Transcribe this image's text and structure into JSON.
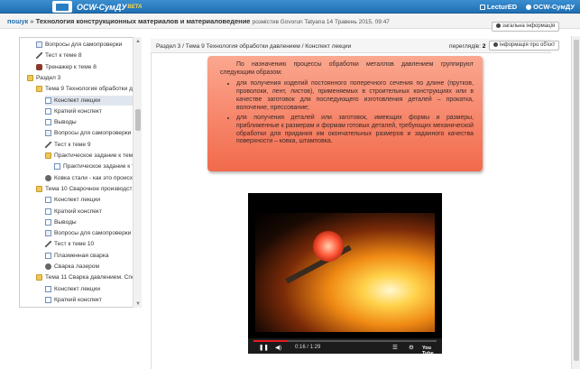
{
  "top_bar": {
    "brand": "ОСW-СумДУ",
    "beta": "BETA",
    "lectured": "LecturED",
    "account": "ОСW-СумДУ"
  },
  "title_bar": {
    "search_link": "пошук",
    "sep": "»",
    "course_title": "Технология конструкционных материалов и материаловедение",
    "author": "розмістив Govorun Tatyana 14 Травень 2015, 09:47",
    "general_info_button": "загальна інформація"
  },
  "sidebar": {
    "items": [
      {
        "label": "Вопросы для самопроверки",
        "icon": "question-icon",
        "indent": 1
      },
      {
        "label": "Тест к теме 8",
        "icon": "pencil-icon",
        "indent": 1
      },
      {
        "label": "Тренажер к теме 8",
        "icon": "wrench-icon",
        "indent": 1
      },
      {
        "label": "Раздел 3",
        "icon": "folder-icon",
        "indent": 0
      },
      {
        "label": "Тема 9 Технология обработки д",
        "icon": "folder-icon",
        "indent": 1
      },
      {
        "label": "Конспект лекции",
        "icon": "doc-icon",
        "indent": 2,
        "selected": true
      },
      {
        "label": "Краткий конспект",
        "icon": "doc-icon",
        "indent": 2
      },
      {
        "label": "Выводы",
        "icon": "doc-icon",
        "indent": 2
      },
      {
        "label": "Вопросы для самопроверки",
        "icon": "question-icon",
        "indent": 2
      },
      {
        "label": "Тест к теме 9",
        "icon": "pencil-icon",
        "indent": 2
      },
      {
        "label": "Практическое задание к теме",
        "icon": "folder-icon",
        "indent": 2
      },
      {
        "label": "Практическое задание к т",
        "icon": "doc-icon",
        "indent": 3
      },
      {
        "label": "Ковка стали - как это происх",
        "icon": "gear-icon",
        "indent": 2
      },
      {
        "label": "Тема 10 Сварочное производст",
        "icon": "folder-icon",
        "indent": 1
      },
      {
        "label": "Конспект лекции",
        "icon": "doc-icon",
        "indent": 2
      },
      {
        "label": "Краткий конспект",
        "icon": "doc-icon",
        "indent": 2
      },
      {
        "label": "Выводы",
        "icon": "doc-icon",
        "indent": 2
      },
      {
        "label": "Вопросы для самопроверки",
        "icon": "question-icon",
        "indent": 2
      },
      {
        "label": "Тест к теме 10",
        "icon": "pencil-icon",
        "indent": 2
      },
      {
        "label": "Плазменная сварка",
        "icon": "doc-icon",
        "indent": 2
      },
      {
        "label": "Сварка лазером",
        "icon": "gear-icon",
        "indent": 2
      },
      {
        "label": "Тема 11 Сварка давлением. Спе",
        "icon": "folder-icon",
        "indent": 1
      },
      {
        "label": "Конспект лекции",
        "icon": "doc-icon",
        "indent": 2
      },
      {
        "label": "Краткий конспект",
        "icon": "doc-icon",
        "indent": 2
      }
    ]
  },
  "content": {
    "path": "Раздел 3 / Тема 9 Технология обработки давлением / Конспект лекции",
    "views_label": "переглядів:",
    "views_count": "2",
    "object_info_button": "інформація про об'єкт",
    "intro": "По назначению процессы обработки металлов давлением группируют следующим образом:",
    "bullets": [
      "для получения изделий постоянного поперечного сечения по длине (прутков, проволоки, лент, листов), применяемых в строительных конструкциях или в качестве заготовок для последующего изготовления деталей – прокатка, волочение, прессование;",
      "для получения деталей или заготовок, имеющих формы и размеры, приближенные к размерам и формам готовых деталей, требующих механической обработки для придания им окончательных размеров и заданного качества поверхности – ковка, штамповка."
    ]
  },
  "video": {
    "time": "0:16 / 1:29",
    "progress": 0.18
  }
}
